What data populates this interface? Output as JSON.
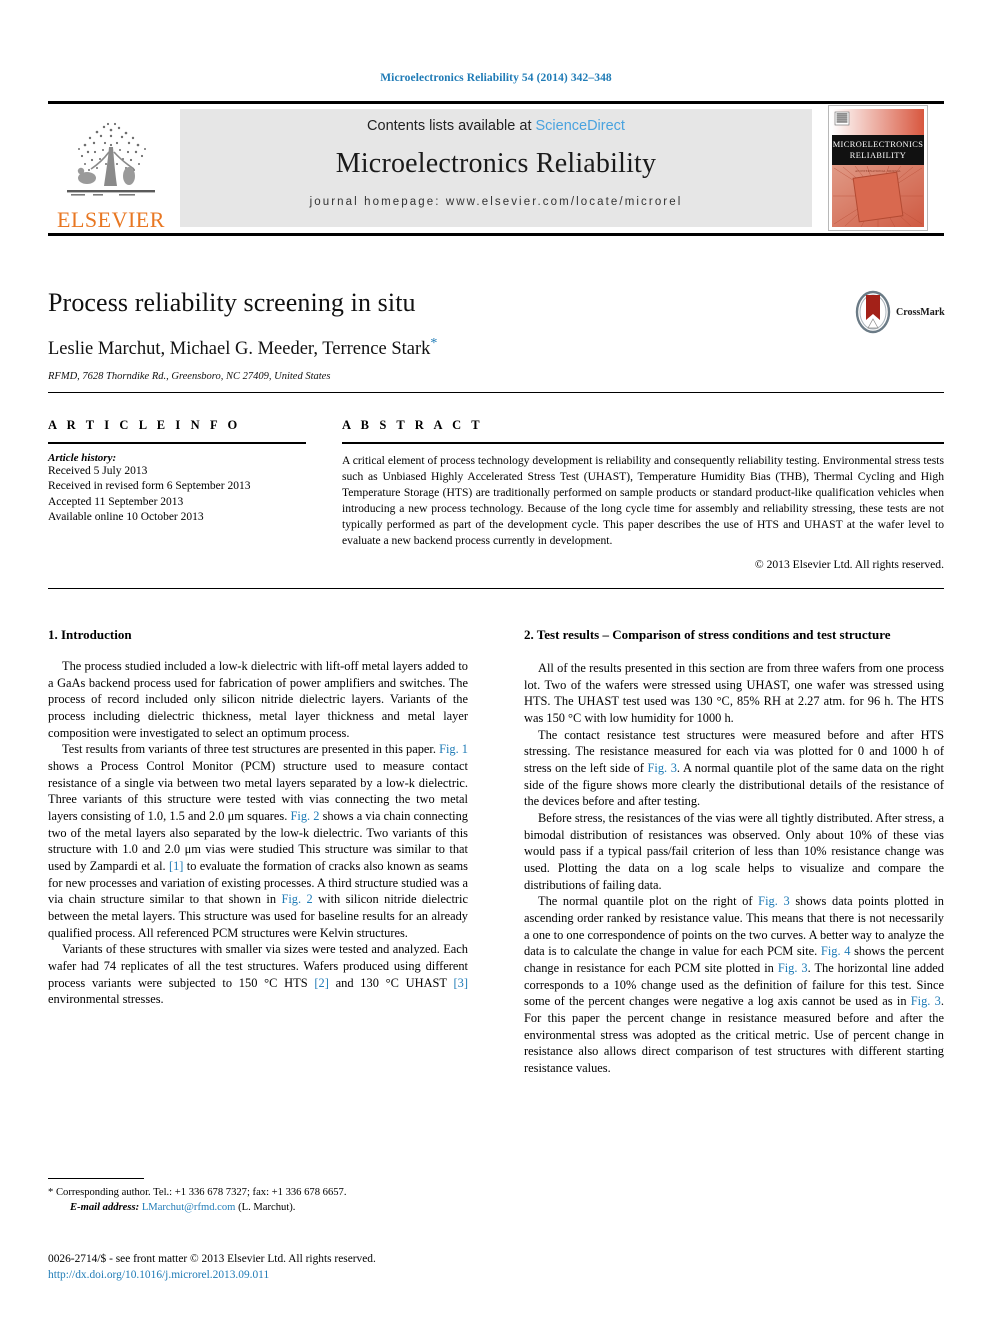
{
  "running_head": "Microelectronics Reliability 54 (2014) 342–348",
  "masthead": {
    "contents_prefix": "Contents lists available at ",
    "sciencedirect": "ScienceDirect",
    "journal_title": "Microelectronics Reliability",
    "homepage": "journal homepage: www.elsevier.com/locate/microrel",
    "publisher_wordmark": "ELSEVIER",
    "cover_line1": "MICROELECTRONICS",
    "cover_line2": "RELIABILITY"
  },
  "title_block": {
    "title": "Process reliability screening in situ",
    "authors": "Leslie Marchut, Michael G. Meeder, Terrence Stark",
    "author_marker": "*",
    "affiliation": "RFMD, 7628 Thorndike Rd., Greensboro, NC 27409, United States",
    "crossmark_label": "CrossMark"
  },
  "article_info": {
    "heading": "A R T I C L E   I N F O",
    "history_label": "Article history:",
    "history": [
      "Received 5 July 2013",
      "Received in revised form 6 September 2013",
      "Accepted 11 September 2013",
      "Available online 10 October 2013"
    ]
  },
  "abstract": {
    "heading": "A B S T R A C T",
    "text": "A critical element of process technology development is reliability and consequently reliability testing. Environmental stress tests such as Unbiased Highly Accelerated Stress Test (UHAST), Temperature Humidity Bias (THB), Thermal Cycling and High Temperature Storage (HTS) are traditionally performed on sample products or standard product-like qualification vehicles when introducing a new process technology. Because of the long cycle time for assembly and reliability stressing, these tests are not typically performed as part of the development cycle. This paper describes the use of HTS and UHAST at the wafer level to evaluate a new backend process currently in development.",
    "copyright": "© 2013 Elsevier Ltd. All rights reserved."
  },
  "sections": {
    "left_heading": "1. Introduction",
    "right_heading": "2. Test results – Comparison of stress conditions and test structure",
    "left_p1": "The process studied included a low-k dielectric with lift-off metal layers added to a GaAs backend process used for fabrication of power amplifiers and switches. The process of record included only silicon nitride dielectric layers. Variants of the process including dielectric thickness, metal layer thickness and metal layer composition were investigated to select an optimum process.",
    "left_p2_a": "Test results from variants of three test structures are presented in this paper. ",
    "left_p2_ref1": "Fig. 1",
    "left_p2_b": " shows a Process Control Monitor (PCM) structure used to measure contact resistance of a single via between two metal layers separated by a low-k dielectric. Three variants of this structure were tested with vias connecting the two metal layers consisting of 1.0, 1.5 and 2.0 μm squares. ",
    "left_p2_ref2": "Fig. 2",
    "left_p2_c": " shows a via chain connecting two of the metal layers also separated by the low-k dielectric. Two variants of this structure with 1.0 and 2.0 μm vias were studied This structure was similar to that used by Zampardi et al. ",
    "left_p2_ref3": "[1]",
    "left_p2_d": " to evaluate the formation of cracks also known as seams for new processes and variation of existing processes. A third structure studied was a via chain structure similar to that shown in ",
    "left_p2_ref4": "Fig. 2",
    "left_p2_e": " with silicon nitride dielectric between the metal layers. This structure was used for baseline results for an already qualified process. All referenced PCM structures were Kelvin structures.",
    "left_p3_a": "Variants of these structures with smaller via sizes were tested and analyzed. Each wafer had 74 replicates of all the test structures. Wafers produced using different process variants were subjected to 150 °C HTS ",
    "left_p3_ref1": "[2]",
    "left_p3_b": " and 130 °C UHAST ",
    "left_p3_ref2": "[3]",
    "left_p3_c": " environmental stresses.",
    "right_p1": "All of the results presented in this section are from three wafers from one process lot. Two of the wafers were stressed using UHAST, one wafer was stressed using HTS. The UHAST test used was 130 °C, 85% RH at 2.27 atm. for 96 h. The HTS was 150 °C with low humidity for 1000 h.",
    "right_p2_a": "The contact resistance test structures were measured before and after HTS stressing. The resistance measured for each via was plotted for 0 and 1000 h of stress on the left side of ",
    "right_p2_ref1": "Fig. 3",
    "right_p2_b": ". A normal quantile plot of the same data on the right side of the figure shows more clearly the distributional details of the resistance of the devices before and after testing.",
    "right_p3": "Before stress, the resistances of the vias were all tightly distributed. After stress, a bimodal distribution of resistances was observed. Only about 10% of these vias would pass if a typical pass/fail criterion of less than 10% resistance change was used. Plotting the data on a log scale helps to visualize and compare the distributions of failing data.",
    "right_p4_a": "The normal quantile plot on the right of ",
    "right_p4_ref1": "Fig. 3",
    "right_p4_b": " shows data points plotted in ascending order ranked by resistance value. This means that there is not necessarily a one to one correspondence of points on the two curves. A better way to analyze the data is to calculate the change in value for each PCM site. ",
    "right_p4_ref2": "Fig. 4",
    "right_p4_c": " shows the percent change in resistance for each PCM site plotted in ",
    "right_p4_ref3": "Fig. 3",
    "right_p4_d": ". The horizontal line added corresponds to a 10% change used as the definition of failure for this test. Since some of the percent changes were negative a log axis cannot be used as in ",
    "right_p4_ref4": "Fig. 3",
    "right_p4_e": ". For this paper the percent change in resistance measured before and after the environmental stress was adopted as the critical metric. Use of percent change in resistance also allows direct comparison of test structures with different starting resistance values."
  },
  "footnote": {
    "marker": "*",
    "corresponding": "Corresponding author. Tel.: +1 336 678 7327; fax: +1 336 678 6657.",
    "email_label": "E-mail address:",
    "email": "LMarchut@rfmd.com",
    "email_owner": "(L. Marchut)."
  },
  "bottom": {
    "issn": "0026-2714/$ - see front matter © 2013 Elsevier Ltd. All rights reserved.",
    "doi": "http://dx.doi.org/10.1016/j.microrel.2013.09.011"
  },
  "colors": {
    "link": "#1f7bb6",
    "sciencedirect": "#4aa3df",
    "elsevier_orange": "#E87722",
    "band_gray": "#e6e6e6"
  }
}
